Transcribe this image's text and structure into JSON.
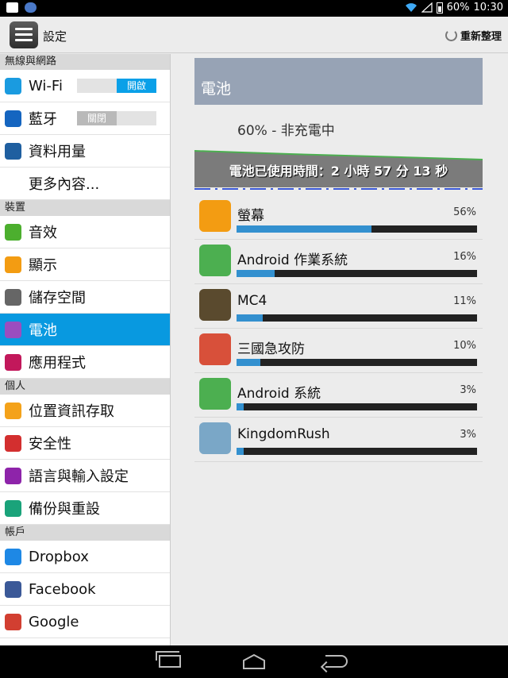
{
  "status_bar": {
    "battery_pct": "60%",
    "time": "10:30"
  },
  "header": {
    "title": "設定",
    "refresh_label": "重新整理"
  },
  "sidebar": {
    "sections": [
      {
        "label": "無線與網路",
        "items": [
          {
            "name": "wifi",
            "icon": "wifi-icon",
            "color": "#1a9be0",
            "label": "Wi-Fi",
            "toggle": "開啟",
            "toggle_state": "on"
          },
          {
            "name": "bluetooth",
            "icon": "bluetooth-icon",
            "color": "#1565c0",
            "label": "藍牙",
            "toggle": "關閉",
            "toggle_state": "off"
          },
          {
            "name": "data-usage",
            "icon": "data-usage-icon",
            "color": "#1f5fa0",
            "label": "資料用量"
          },
          {
            "name": "more",
            "icon": "",
            "label": "更多內容..."
          }
        ]
      },
      {
        "label": "裝置",
        "items": [
          {
            "name": "sound",
            "icon": "speaker-icon",
            "color": "#4caf2e",
            "label": "音效"
          },
          {
            "name": "display",
            "icon": "brightness-icon",
            "color": "#f39c12",
            "label": "顯示"
          },
          {
            "name": "storage",
            "icon": "storage-icon",
            "color": "#666666",
            "label": "儲存空間"
          },
          {
            "name": "battery",
            "icon": "battery-icon",
            "color": "#9b4dbf",
            "label": "電池",
            "selected": true
          },
          {
            "name": "apps",
            "icon": "apps-icon",
            "color": "#c2185b",
            "label": "應用程式"
          }
        ]
      },
      {
        "label": "個人",
        "items": [
          {
            "name": "location",
            "icon": "location-icon",
            "color": "#f4a21a",
            "label": "位置資訊存取"
          },
          {
            "name": "security",
            "icon": "lock-icon",
            "color": "#d32f2f",
            "label": "安全性"
          },
          {
            "name": "language",
            "icon": "language-icon",
            "color": "#8e24aa",
            "label": "語言與輸入設定"
          },
          {
            "name": "backup",
            "icon": "backup-icon",
            "color": "#1aa37a",
            "label": "備份與重設"
          }
        ]
      },
      {
        "label": "帳戶",
        "items": [
          {
            "name": "dropbox",
            "icon": "dropbox-icon",
            "color": "#1e88e5",
            "label": "Dropbox"
          },
          {
            "name": "facebook",
            "icon": "facebook-icon",
            "color": "#3b5998",
            "label": "Facebook"
          },
          {
            "name": "google",
            "icon": "google-icon",
            "color": "#d23f31",
            "label": "Google"
          }
        ]
      }
    ]
  },
  "content": {
    "title": "電池",
    "status": "60% - 非充電中",
    "usage_time": "電池已使用時間：2 小時 57 分 13 秒",
    "apps": [
      {
        "name": "螢幕",
        "icon": "brightness-icon",
        "color": "#f39c12",
        "pct": "56%",
        "value": 0.56
      },
      {
        "name": "Android 作業系統",
        "icon": "android-os-icon",
        "color": "#4caf50",
        "pct": "16%",
        "value": 0.16
      },
      {
        "name": "MC4",
        "icon": "mc4-icon",
        "color": "#5a4a2e",
        "pct": "11%",
        "value": 0.11
      },
      {
        "name": "三國急攻防",
        "icon": "three-kingdoms-icon",
        "color": "#d8503a",
        "pct": "10%",
        "value": 0.1
      },
      {
        "name": "Android 系統",
        "icon": "android-system-icon",
        "color": "#4caf50",
        "pct": "3%",
        "value": 0.03
      },
      {
        "name": "KingdomRush",
        "icon": "kingdomrush-icon",
        "color": "#7aa7c7",
        "pct": "3%",
        "value": 0.03
      }
    ]
  },
  "nav_bar": {
    "buttons": [
      "recents-icon",
      "home-icon",
      "back-icon"
    ]
  }
}
